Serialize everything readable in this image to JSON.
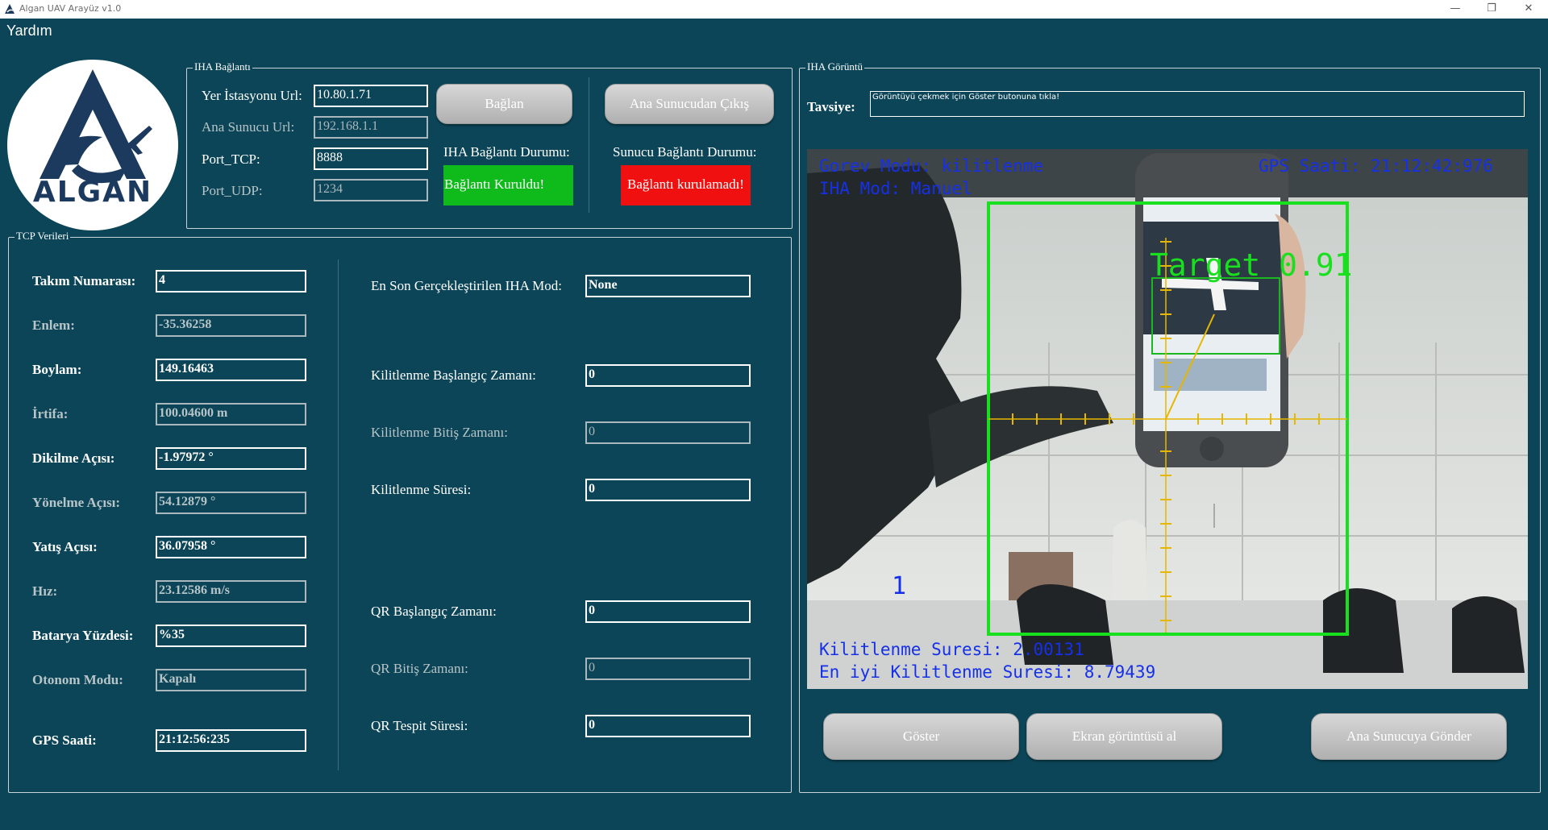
{
  "window": {
    "title": "Algan UAV Arayüz v1.0"
  },
  "menu": {
    "help": "Yardım"
  },
  "logo": {
    "text": "ALGAN",
    "color": "#1c3a5e"
  },
  "connection": {
    "group_title": "IHA Bağlantı",
    "ground_station_url_label": "Yer İstasyonu Url:",
    "ground_station_url": "10.80.1.71",
    "main_server_url_label": "Ana Sunucu Url:",
    "main_server_url": "192.168.1.1",
    "port_tcp_label": "Port_TCP:",
    "port_tcp": "8888",
    "port_udp_label": "Port_UDP:",
    "port_udp": "1234",
    "connect_button": "Bağlan",
    "exit_button": "Ana Sunucudan Çıkış",
    "uav_status_label": "IHA Bağlantı Durumu:",
    "uav_status_value": "Bağlantı Kuruldu!",
    "uav_status_color": "#0fba1b",
    "server_status_label": "Sunucu Bağlantı Durumu:",
    "server_status_value": "Bağlantı kurulamadı!",
    "server_status_color": "#f01010"
  },
  "tcp": {
    "group_title": "TCP Verileri",
    "team_number_label": "Takım Numarası:",
    "team_number": "4",
    "latitude_label": "Enlem:",
    "latitude": "-35.36258",
    "longitude_label": "Boylam:",
    "longitude": "149.16463",
    "altitude_label": "İrtifa:",
    "altitude": "100.04600 m",
    "pitch_label": "Dikilme Açısı:",
    "pitch": "-1.97972 °",
    "heading_label": "Yönelme Açısı:",
    "heading": "54.12879 °",
    "roll_label": "Yatış Açısı:",
    "roll": "36.07958 °",
    "speed_label": "Hız:",
    "speed": "23.12586 m/s",
    "battery_label": "Batarya Yüzdesi:",
    "battery": "%35",
    "autonomous_label": "Otonom Modu:",
    "autonomous": "Kapalı",
    "gps_time_label": "GPS Saati:",
    "gps_time": "21:12:56:235",
    "last_mode_label": "En Son Gerçekleştirilen IHA Mod:",
    "last_mode": "None",
    "lock_start_label": "Kilitlenme Başlangıç Zamanı:",
    "lock_start": "0",
    "lock_end_label": "Kilitlenme Bitiş Zamanı:",
    "lock_end": "0",
    "lock_duration_label": "Kilitlenme Süresi:",
    "lock_duration": "0",
    "qr_start_label": "QR Başlangıç Zamanı:",
    "qr_start": "0",
    "qr_end_label": "QR Bitiş Zamanı:",
    "qr_end": "0",
    "qr_duration_label": "QR Tespit Süresi:",
    "qr_duration": "0"
  },
  "view": {
    "group_title": "IHA Görüntü",
    "advice_label": "Tavsiye:",
    "advice": "Görüntüyü çekmek için Göster butonuna tıkla!",
    "show_button": "Göster",
    "screenshot_button": "Ekran görüntüsü al",
    "send_button": "Ana Sunucuya Gönder",
    "osd": {
      "mission_mode": "Gorev Modu: kilitlenme",
      "uav_mode": "IHA Mod: Manuel",
      "gps_time": "GPS Saati: 21:12:42:976",
      "target": "Target 0.91",
      "lock_duration": "Kilitlenme Suresi: 2.00131",
      "best_lock": "En iyi Kilitlenme Suresi: 8.79439",
      "counter": "1"
    }
  }
}
